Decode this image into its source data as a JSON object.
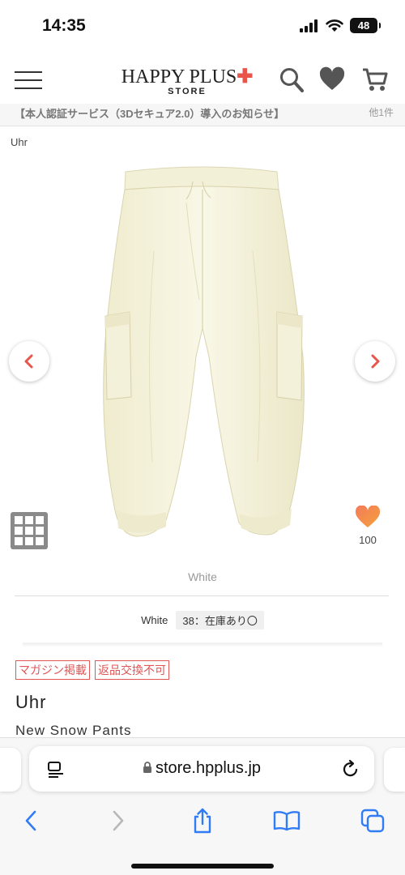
{
  "status_bar": {
    "time": "14:35",
    "battery": "48"
  },
  "header": {
    "logo_main": "HAPPY PLUS",
    "logo_sub": "STORE",
    "icons": [
      "menu-icon",
      "search-icon",
      "heart-icon",
      "cart-icon"
    ]
  },
  "announcement": {
    "text": "【本人認証サービス（3Dセキュア2.0）導入のお知らせ】",
    "more": "他1件"
  },
  "product": {
    "brand_small": "Uhr",
    "color_caption": "White",
    "like_count": "100",
    "stock": {
      "color": "White",
      "size_status": "38：在庫あり〇"
    },
    "tags": [
      "マガジン掲載",
      "返品交換不可"
    ],
    "brand": "Uhr",
    "name": "New Snow Pants"
  },
  "browser": {
    "url": "store.hpplus.jp",
    "toolbar": [
      "back-icon",
      "forward-icon",
      "share-icon",
      "bookmarks-icon",
      "tabs-icon"
    ]
  },
  "colors": {
    "accent": "#e8554a",
    "tag_red": "#e05555",
    "ios_blue": "#2f7cf6",
    "fabric": "#f6f3df"
  }
}
